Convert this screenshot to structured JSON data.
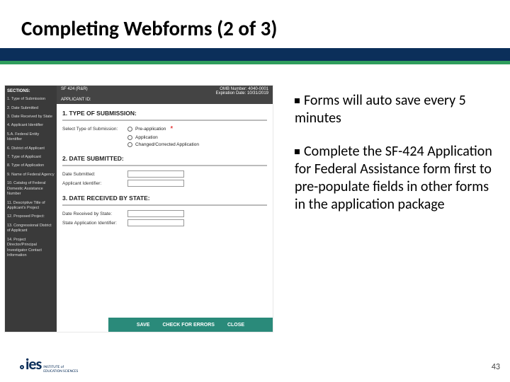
{
  "title": "Completing Webforms (2 of 3)",
  "bullets": {
    "b1": "Forms will auto save every 5 minutes",
    "b2": "Complete the SF-424 Application for Federal Assistance form first to pre-populate fields in other forms in the application package"
  },
  "form": {
    "sections_header": "SECTIONS:",
    "sections": {
      "s1": "1. Type of Submission",
      "s2": "2. Date Submitted",
      "s3": "3. Date Received by State",
      "s4": "4. Applicant Identifier",
      "s5": "5.A. Federal Entity Identifier",
      "s6": "6. District of Applicant",
      "s7": "7. Type of Applicant",
      "s8": "8. Type of Application",
      "s9": "9. Name of Federal Agency",
      "s10": "10. Catalog of Federal Domestic Assistance Number",
      "s11": "11. Descriptive Title of Applicant's Project",
      "s12": "12. Proposed Project:",
      "s13": "13. Congressional District of Applicant",
      "s14": "14. Project Director/Principal Investigator Contact Information"
    },
    "topbar_left": "SF 424 (R&R)",
    "topbar_right_a": "OMB Number: 4040-0001",
    "topbar_right_b": "Expiration Date: 10/31/2019",
    "topbar_applicant": "APPLICANT ID:",
    "sec1_title": "1. TYPE OF SUBMISSION:",
    "sec1_label": "Select Type of Submission:",
    "sec1_opt1": "Pre-application",
    "sec1_opt2": "Application",
    "sec1_opt3": "Changed/Corrected Application",
    "sec2_title": "2. DATE SUBMITTED:",
    "sec2_r1": "Date Submitted:",
    "sec2_r2": "Applicant Identifier:",
    "sec3_title": "3. DATE RECEIVED BY STATE:",
    "sec3_r1": "Date Received by State:",
    "sec3_r2": "State Application Identifier:",
    "btn_save": "SAVE",
    "btn_check": "CHECK FOR ERRORS",
    "btn_close": "CLOSE"
  },
  "logo": {
    "ies": "ies",
    "tag1": "INSTITUTE of",
    "tag2": "EDUCATION SCIENCES"
  },
  "page_number": "43"
}
